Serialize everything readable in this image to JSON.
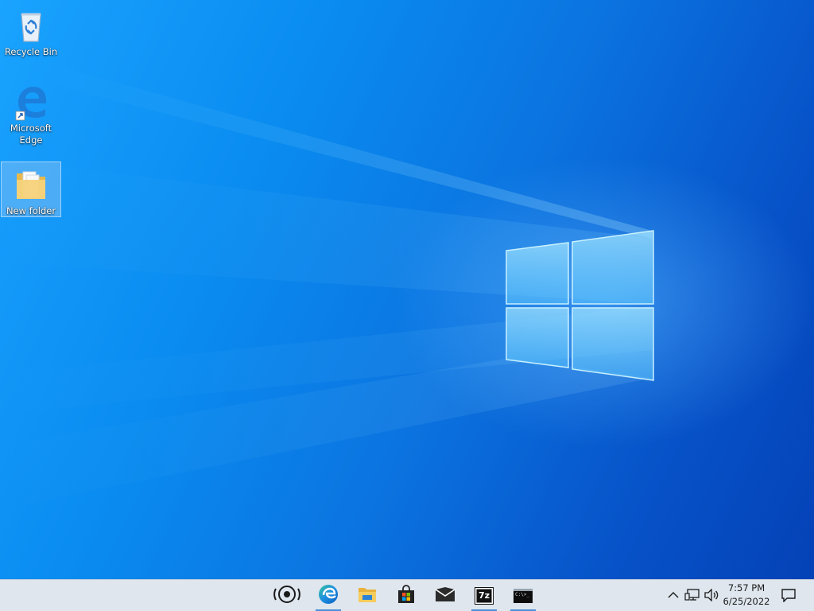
{
  "desktop": {
    "icons": [
      {
        "label": "Recycle Bin",
        "icon": "recycle-bin-icon"
      },
      {
        "label": "Microsoft Edge",
        "label_line1": "Microsoft",
        "label_line2": "Edge",
        "icon": "edge-icon"
      },
      {
        "label": "New folder",
        "icon": "folder-icon",
        "selected": true
      }
    ]
  },
  "taskbar": {
    "apps": [
      {
        "name": "cortana",
        "icon": "cortana-icon",
        "running": false
      },
      {
        "name": "microsoft-edge",
        "icon": "edge-icon",
        "running": true
      },
      {
        "name": "file-explorer",
        "icon": "file-explorer-icon",
        "running": false
      },
      {
        "name": "microsoft-store",
        "icon": "store-icon",
        "running": false
      },
      {
        "name": "mail",
        "icon": "mail-icon",
        "running": false
      },
      {
        "name": "7-zip",
        "icon": "7zip-icon",
        "label": "7z",
        "running": true
      },
      {
        "name": "command-prompt",
        "icon": "cmd-icon",
        "label": "C:\\>_",
        "running": true
      }
    ],
    "tray": {
      "icons": [
        "chevron-up-icon",
        "network-icon",
        "volume-icon"
      ],
      "time": "7:57 PM",
      "date": "6/25/2022"
    },
    "notification_icon": "action-center-icon"
  },
  "colors": {
    "wallpaper_light": "#1aa3ff",
    "wallpaper_dark": "#0440b5",
    "taskbar_bg": "#dfe6ee",
    "running_indicator": "#4a8fd8"
  }
}
